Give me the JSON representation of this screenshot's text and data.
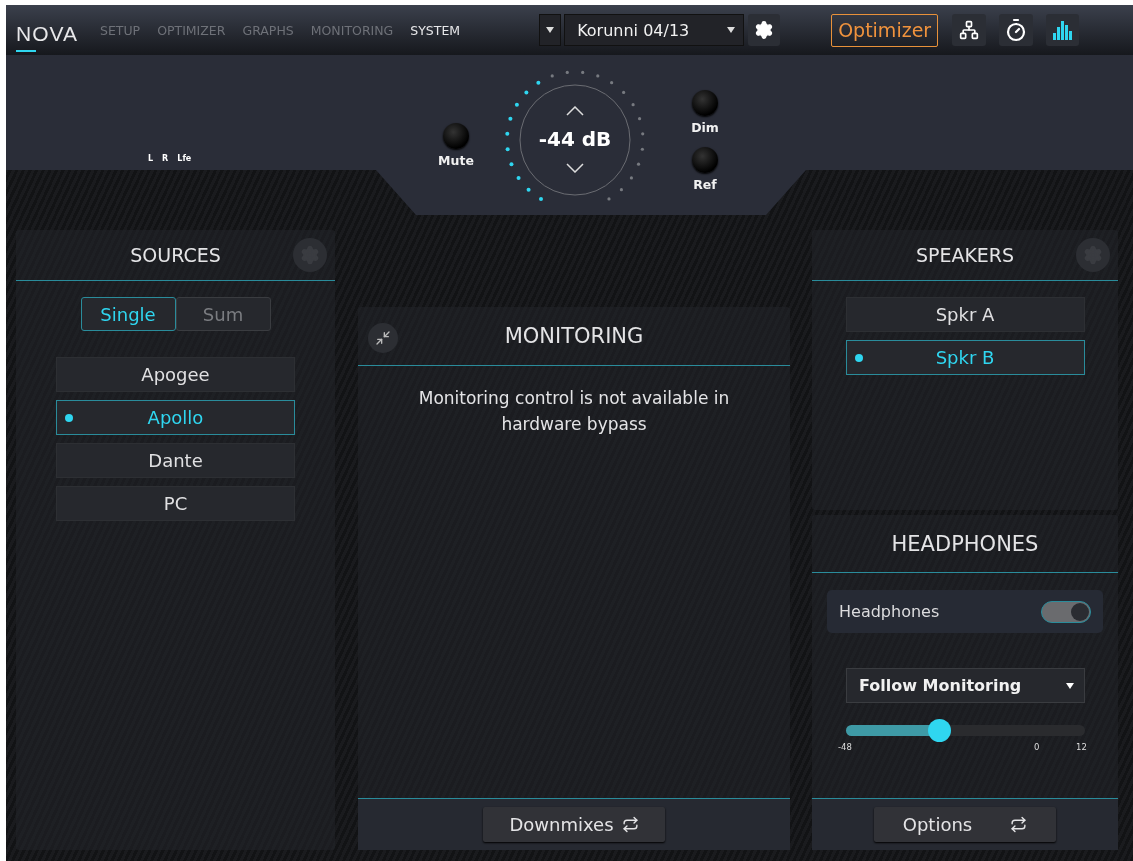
{
  "nav": {
    "logo": "NOVA",
    "tabs": [
      {
        "label": "SETUP",
        "selected": false
      },
      {
        "label": "OPTIMIZER",
        "selected": false
      },
      {
        "label": "GRAPHS",
        "selected": false
      },
      {
        "label": "MONITORING",
        "selected": false
      },
      {
        "label": "SYSTEM",
        "selected": true
      }
    ]
  },
  "preset": {
    "value": "Korunni 04/13"
  },
  "optimizer_button": "Optimizer",
  "meter_labels": [
    "L",
    "R",
    "Lfe"
  ],
  "volume": {
    "reading": "-44 dB",
    "level": 0.43
  },
  "round_buttons": [
    {
      "label": "Mute"
    },
    {
      "label": "Dim"
    },
    {
      "label": "Ref"
    }
  ],
  "sources": {
    "title": "SOURCES",
    "modes": [
      {
        "label": "Single",
        "selected": true
      },
      {
        "label": "Sum",
        "selected": false
      }
    ],
    "items": [
      {
        "label": "Apogee",
        "selected": false
      },
      {
        "label": "Apollo",
        "selected": true
      },
      {
        "label": "Dante",
        "selected": false
      },
      {
        "label": "PC",
        "selected": false
      }
    ]
  },
  "monitoring": {
    "title": "MONITORING",
    "message": "Monitoring control is not available in hardware bypass",
    "footer_button": "Downmixes"
  },
  "speakers": {
    "title": "SPEAKERS",
    "items": [
      {
        "label": "Spkr A",
        "selected": false
      },
      {
        "label": "Spkr B",
        "selected": true
      }
    ]
  },
  "headphones": {
    "title": "HEADPHONES",
    "toggle": {
      "label": "Headphones",
      "on": true
    },
    "dropdown": {
      "value": "Follow Monitoring"
    },
    "slider": {
      "level": 0.39,
      "ticks": [
        "-48",
        "0",
        "12"
      ]
    },
    "footer_button": "Options"
  }
}
